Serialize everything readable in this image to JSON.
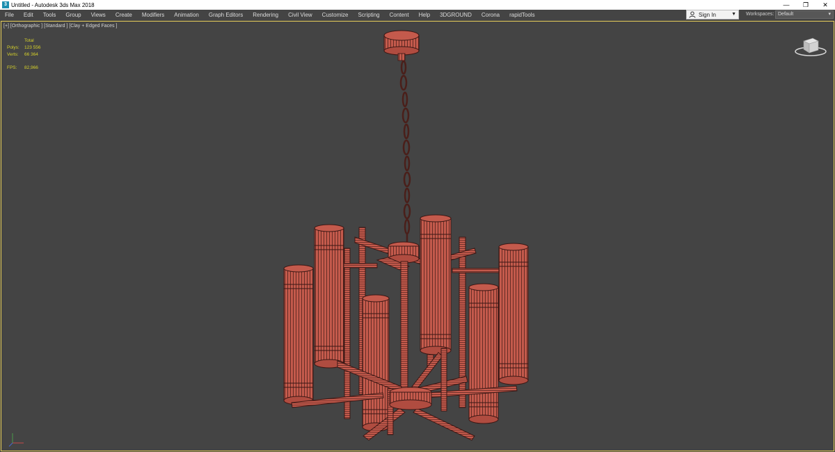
{
  "window": {
    "title": "Untitled - Autodesk 3ds Max 2018",
    "controls": {
      "minimize": "—",
      "restore": "❐",
      "close": "✕"
    }
  },
  "menu": {
    "items": [
      "File",
      "Edit",
      "Tools",
      "Group",
      "Views",
      "Create",
      "Modifiers",
      "Animation",
      "Graph Editors",
      "Rendering",
      "Civil View",
      "Customize",
      "Scripting",
      "Content",
      "Help",
      "3DGROUND",
      "Corona",
      "rapidTools"
    ],
    "signin_label": "Sign In",
    "workspaces_label": "Workspaces:",
    "workspace_value": "Default"
  },
  "viewport": {
    "label": "[+] [Orthographic ] [Standard ] [Clay + Edged Faces ]",
    "stats": {
      "total_label": "Total",
      "polys_label": "Polys:",
      "polys_value": "123 556",
      "verts_label": "Verts:",
      "verts_value": "66 364",
      "fps_label": "FPS:",
      "fps_value": "82,966"
    }
  },
  "colors": {
    "viewport_bg": "#444444",
    "active_border": "#e8cf5a",
    "model_fill": "#c45a4c",
    "model_edge": "#3a1714",
    "stats_text": "#d6d12a"
  }
}
